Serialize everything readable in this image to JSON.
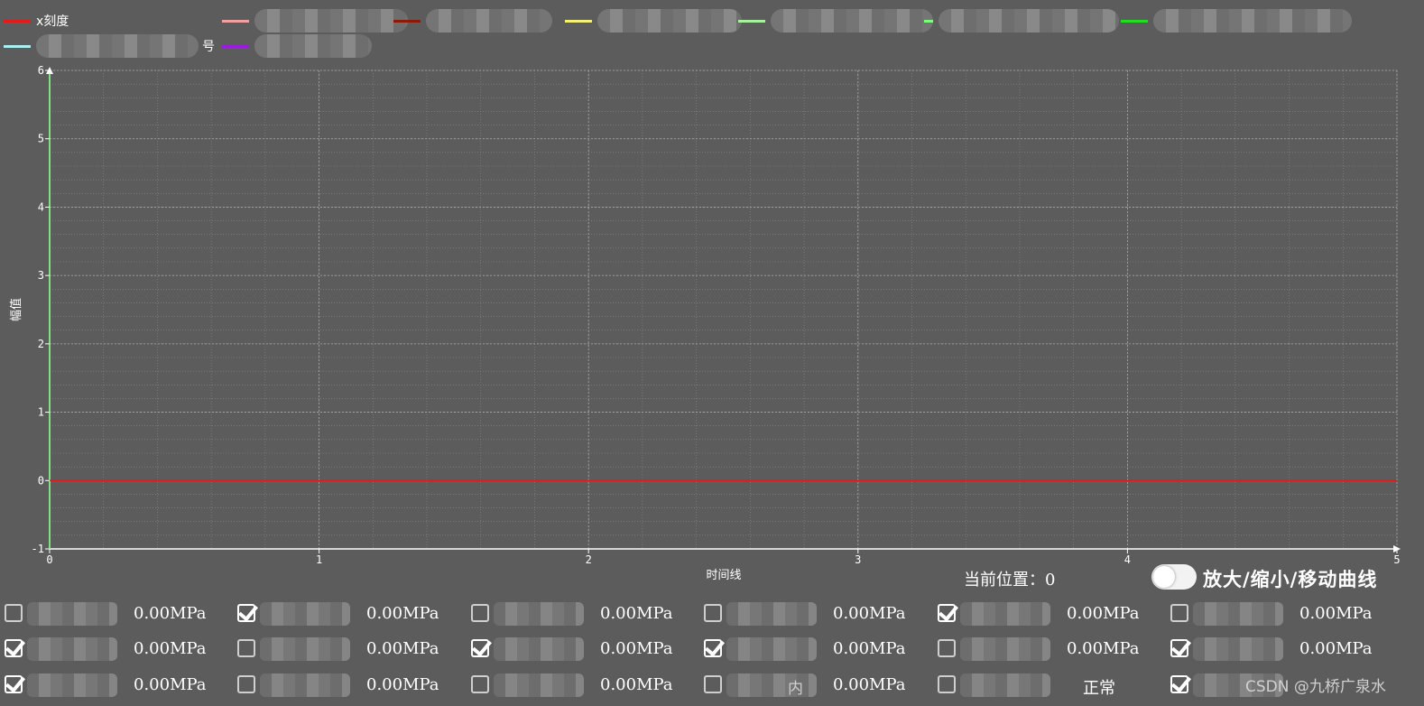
{
  "legend": {
    "row1": [
      {
        "label": "x刻度",
        "color": "#e11a1a"
      },
      {
        "label": "",
        "color": "#f0a0a0"
      },
      {
        "label": "",
        "color": "#8b1a0a"
      },
      {
        "label": "",
        "color": "#f5f07a"
      },
      {
        "label": "",
        "color": "#a8f0a0"
      },
      {
        "label": "",
        "color": "#7aff7a"
      },
      {
        "label": "",
        "color": "#22dd22"
      }
    ],
    "row2": [
      {
        "label": "号",
        "color": "#aaf0f0"
      },
      {
        "label": "",
        "color": "#9a1ae0"
      }
    ]
  },
  "chart_data": {
    "type": "line",
    "xlabel": "时间线",
    "ylabel": "幅值",
    "xlim": [
      0,
      5
    ],
    "ylim": [
      -1,
      6
    ],
    "x_ticks": [
      "0",
      "1",
      "2",
      "3",
      "4",
      "5"
    ],
    "y_ticks": [
      "-1",
      "0",
      "1",
      "2",
      "3",
      "4",
      "5",
      "6"
    ],
    "grid": true,
    "series": [
      {
        "color": "#e11a1a",
        "x": [
          0,
          5
        ],
        "y": [
          0,
          0
        ]
      }
    ]
  },
  "status": {
    "position_label": "当前位置：",
    "position_value": "0"
  },
  "toggle": {
    "label": "放大/缩小/移动曲线",
    "on": false
  },
  "sensors": [
    [
      {
        "checked": false,
        "value": "0.00MPa",
        "suffix": ""
      },
      {
        "checked": true,
        "value": "0.00MPa",
        "suffix": ""
      },
      {
        "checked": false,
        "value": "0.00MPa",
        "suffix": ""
      },
      {
        "checked": false,
        "value": "0.00MPa",
        "suffix": ""
      },
      {
        "checked": true,
        "value": "0.00MPa",
        "suffix": ""
      },
      {
        "checked": false,
        "value": "0.00MPa",
        "suffix": ""
      }
    ],
    [
      {
        "checked": true,
        "value": "0.00MPa",
        "suffix": ""
      },
      {
        "checked": false,
        "value": "0.00MPa",
        "suffix": ""
      },
      {
        "checked": true,
        "value": "0.00MPa",
        "suffix": ""
      },
      {
        "checked": true,
        "value": "0.00MPa",
        "suffix": ""
      },
      {
        "checked": false,
        "value": "0.00MPa",
        "suffix": ""
      },
      {
        "checked": true,
        "value": "0.00MPa",
        "suffix": ""
      }
    ],
    [
      {
        "checked": true,
        "value": "0.00MPa",
        "suffix": ""
      },
      {
        "checked": false,
        "value": "0.00MPa",
        "suffix": ""
      },
      {
        "checked": false,
        "value": "0.00MPa",
        "suffix": ""
      },
      {
        "checked": false,
        "value": "0.00MPa",
        "suffix": "内"
      },
      {
        "checked": false,
        "value": "正常",
        "suffix": ""
      },
      {
        "checked": true,
        "value": "",
        "suffix": ""
      }
    ]
  ],
  "watermark": "CSDN @九桥广泉水"
}
